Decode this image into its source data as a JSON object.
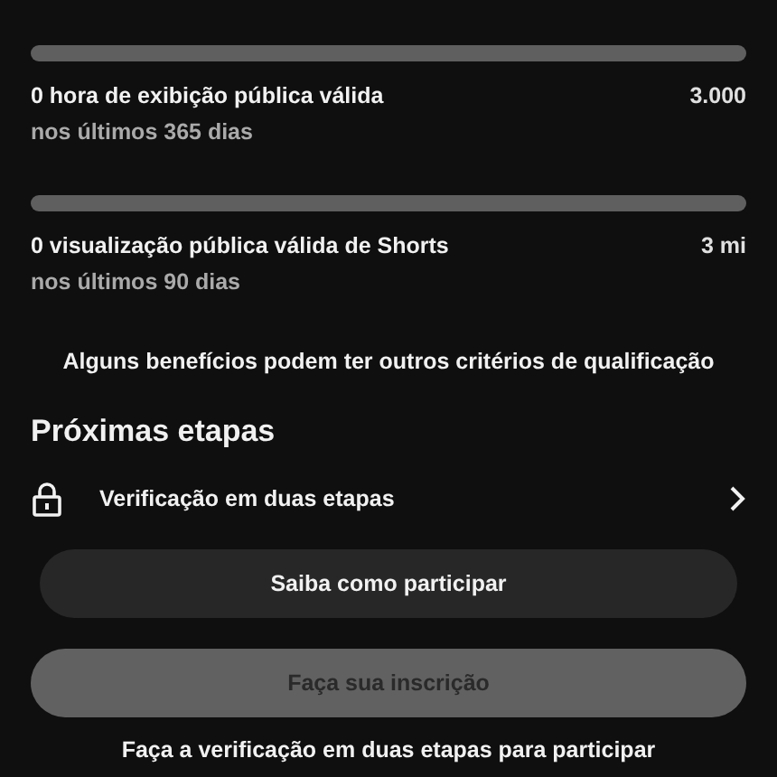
{
  "requirements": [
    {
      "label": "0 hora de exibição pública válida",
      "target": "3.000",
      "period": "nos últimos 365 dias",
      "level": 0
    },
    {
      "label": "0 visualização pública válida de Shorts",
      "target": "3 mi",
      "period": "nos últimos 90 dias",
      "level": 0
    }
  ],
  "note": "Alguns benefícios podem ter outros critérios de qualificação",
  "next_steps": {
    "title": "Próximas etapas",
    "items": [
      {
        "label": "Verificação em duas etapas"
      }
    ]
  },
  "buttons": [
    {
      "label": "Saiba como participar",
      "disabled": false
    },
    {
      "label": "Faça sua inscrição",
      "disabled": true
    }
  ],
  "footer": "Faça a verificação em duas etapas para participar"
}
